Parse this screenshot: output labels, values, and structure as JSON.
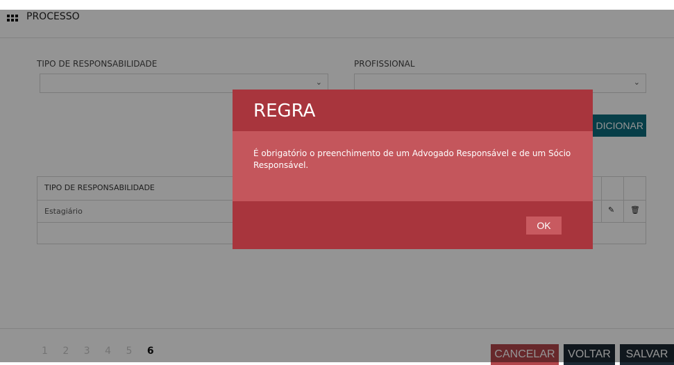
{
  "header": {
    "title": "PROCESSO",
    "icon": "grid-icon"
  },
  "form": {
    "tipo_label": "TIPO DE RESPONSABILIDADE",
    "profissional_label": "PROFISSIONAL",
    "tipo_value": "",
    "profissional_value": "",
    "add_button_label": "DICIONAR"
  },
  "table": {
    "header": "TIPO DE RESPONSABILIDADE",
    "rows": [
      {
        "tipo": "Estagiário"
      }
    ]
  },
  "pagination": {
    "pages": [
      "1",
      "2",
      "3",
      "4",
      "5",
      "6"
    ],
    "active": "6"
  },
  "footer": {
    "cancel_label": "CANCELAR",
    "back_label": "VOLTAR",
    "save_label": "SALVAR"
  },
  "modal": {
    "title": "REGRA",
    "message": "É obrigatório o preenchimento de um Advogado Responsável e de um Sócio Responsável.",
    "ok_label": "OK"
  },
  "colors": {
    "modal_dark": "#a8353d",
    "modal_body": "#c4565c",
    "add_button": "#0d6b7d",
    "cancel_button": "#b2454b",
    "footer_dark": "#1c2833"
  }
}
